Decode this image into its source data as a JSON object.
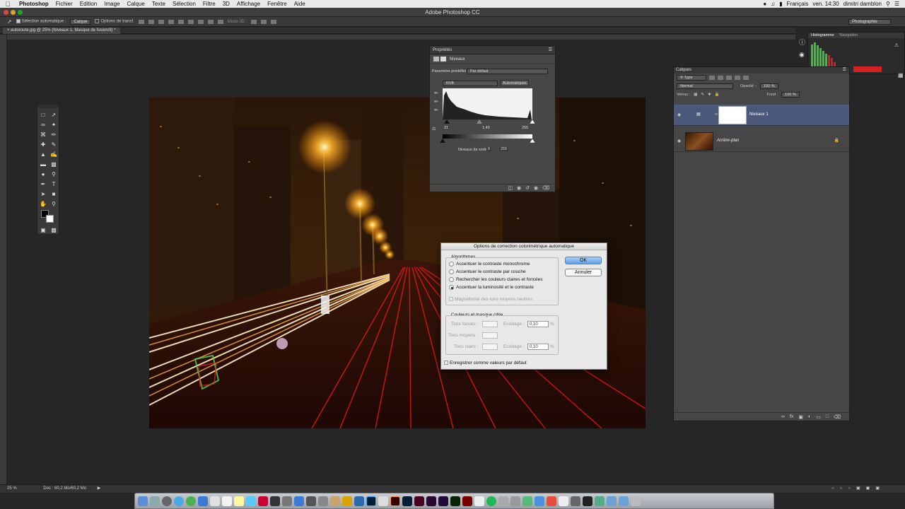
{
  "menubar": {
    "items": [
      "Photoshop",
      "Fichier",
      "Edition",
      "Image",
      "Calque",
      "Texte",
      "Sélection",
      "Filtre",
      "3D",
      "Affichage",
      "Fenêtre",
      "Aide"
    ],
    "language": "Français",
    "clock": "ven. 14:30",
    "user": "dimitri damblon"
  },
  "window": {
    "title": "Adobe Photoshop CC",
    "workspace": "Photographie"
  },
  "options_bar": {
    "auto_select_label": "Sélection automatique :",
    "auto_select_value": "Calque",
    "transform_label": "Options de transf.",
    "mode3d_label": "Mode 3D :"
  },
  "document": {
    "tab_title": "autoroute.jpg @ 25% (Niveaux 1, Masque de fusion/8) *"
  },
  "properties": {
    "panel_title": "Propriétés",
    "adjustment_name": "Niveaux",
    "preset_label": "Paramètre prédéfini :",
    "preset_value": "Par défaut",
    "channel": "RVB",
    "auto_button": "Automatiques",
    "input_black": "21",
    "input_mid": "1,40",
    "input_white": "255",
    "output_label": "Niveaux de sortie :",
    "output_black": "0",
    "output_white": "255"
  },
  "dialog": {
    "title": "Options de correction colorimétrique automatique",
    "algorithms_label": "Algorithmes",
    "options": [
      {
        "label": "Accentuer le contraste monochrome",
        "selected": false
      },
      {
        "label": "Accentuer le contraste par couche",
        "selected": false
      },
      {
        "label": "Rechercher les couleurs claires et foncées",
        "selected": false
      },
      {
        "label": "Accentuer la luminosité et le contraste",
        "selected": true
      }
    ],
    "neutral_label": "Magnétisme des tons moyens neutres",
    "targets_label": "Couleurs et masque cible",
    "shadows_label": "Tons foncés :",
    "midtones_label": "Tons moyens :",
    "highlights_label": "Tons clairs :",
    "clip_label": "Ecrêtage :",
    "clip_shadows": "0,10",
    "clip_highlights": "0,10",
    "percent": "%",
    "save_default_label": "Enregistrer comme valeurs par défaut",
    "ok_label": "OK",
    "cancel_label": "Annuler"
  },
  "histogram_panel": {
    "tabs": [
      "Histogramme",
      "Navigation"
    ]
  },
  "layers": {
    "panel_title": "Calques",
    "filter_kind": "Type",
    "blend_mode": "Normal",
    "opacity_label": "Opacité :",
    "opacity_value": "100 %",
    "lock_label": "Verrou :",
    "fill_label": "Fond :",
    "fill_value": "100 %",
    "items": [
      {
        "name": "Niveaux 1",
        "selected": true
      },
      {
        "name": "Arrière-plan",
        "selected": false
      }
    ]
  },
  "status": {
    "zoom": "25 %",
    "doc_info": "Doc : 60,2 Mo/60,2 Mo"
  },
  "colors": {
    "accent": "#4b6cb4",
    "dialog_bg": "#e8e8e8",
    "panel_bg": "#464646"
  }
}
